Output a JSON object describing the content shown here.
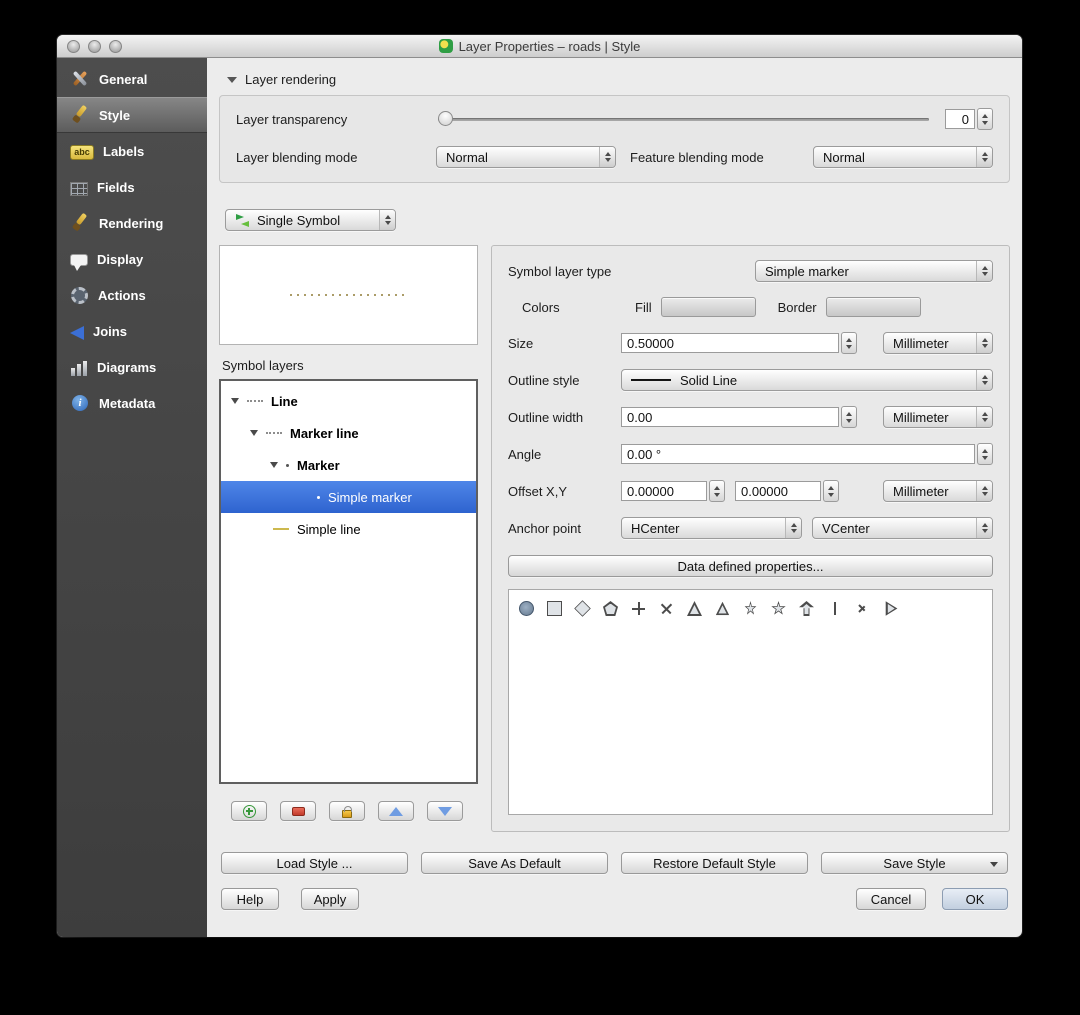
{
  "window": {
    "title": "Layer Properties – roads | Style"
  },
  "sidebar": {
    "items": [
      {
        "label": "General"
      },
      {
        "label": "Style"
      },
      {
        "label": "Labels",
        "icon_text": "abc"
      },
      {
        "label": "Fields"
      },
      {
        "label": "Rendering"
      },
      {
        "label": "Display"
      },
      {
        "label": "Actions"
      },
      {
        "label": "Joins"
      },
      {
        "label": "Diagrams"
      },
      {
        "label": "Metadata",
        "icon_text": "i"
      }
    ]
  },
  "layer_rendering": {
    "header": "Layer rendering",
    "transparency": {
      "label": "Layer transparency",
      "value": "0"
    },
    "layer_blending": {
      "label": "Layer blending mode",
      "value": "Normal"
    },
    "feature_blending": {
      "label": "Feature blending mode",
      "value": "Normal"
    }
  },
  "renderer": {
    "value": "Single Symbol"
  },
  "symbol_layers": {
    "label": "Symbol layers",
    "tree": [
      {
        "label": "Line"
      },
      {
        "label": "Marker line"
      },
      {
        "label": "Marker"
      },
      {
        "label": "Simple marker"
      },
      {
        "label": "Simple line"
      }
    ]
  },
  "properties": {
    "symbol_layer_type": {
      "label": "Symbol layer type",
      "value": "Simple marker"
    },
    "colors": {
      "label": "Colors",
      "fill_label": "Fill",
      "border_label": "Border"
    },
    "size": {
      "label": "Size",
      "value": "0.50000",
      "unit": "Millimeter"
    },
    "outline_style": {
      "label": "Outline style",
      "value": "Solid Line"
    },
    "outline_width": {
      "label": "Outline width",
      "value": "0.00",
      "unit": "Millimeter"
    },
    "angle": {
      "label": "Angle",
      "value": "0.00 °"
    },
    "offset": {
      "label": "Offset X,Y",
      "x": "0.00000",
      "y": "0.00000",
      "unit": "Millimeter"
    },
    "anchor": {
      "label": "Anchor point",
      "h": "HCenter",
      "v": "VCenter"
    },
    "data_defined": "Data defined properties...",
    "marker_shapes": [
      "circle",
      "square",
      "diamond",
      "pentagon",
      "cross",
      "cross2",
      "triangle",
      "equilateral-triangle",
      "star",
      "regular-star",
      "arrow",
      "line",
      "chevron",
      "filled-arrowhead"
    ]
  },
  "style_buttons": {
    "load": "Load Style ...",
    "save_default": "Save As Default",
    "restore": "Restore Default Style",
    "save": "Save Style"
  },
  "actions": {
    "help": "Help",
    "apply": "Apply",
    "cancel": "Cancel",
    "ok": "OK"
  },
  "theme_colors": {
    "tree_selection": "#3b74d9",
    "sidebar_bg": "#454545",
    "window_bg": "#ececec"
  }
}
